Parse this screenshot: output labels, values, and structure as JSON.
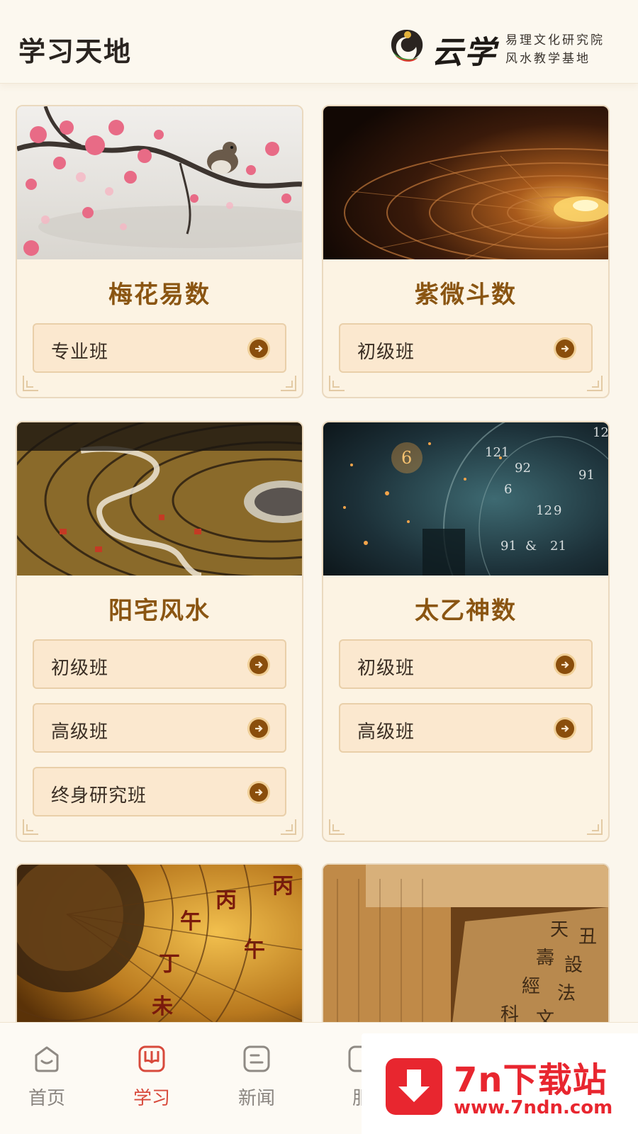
{
  "header": {
    "title": "学习天地",
    "logo": {
      "main": "云学",
      "line1": "易理文化研究院",
      "line2": "风水教学基地"
    }
  },
  "courses": [
    {
      "title": "梅花易数",
      "image": "plum-blossom-bird-image",
      "classes": [
        "专业班"
      ]
    },
    {
      "title": "紫微斗数",
      "image": "glowing-astrolabe-image",
      "classes": [
        "初级班"
      ]
    },
    {
      "title": "阳宅风水",
      "image": "luopan-compass-image",
      "classes": [
        "初级班",
        "高级班",
        "终身研究班"
      ]
    },
    {
      "title": "太乙神数",
      "image": "cosmic-numbers-image",
      "classes": [
        "初级班",
        "高级班"
      ]
    },
    {
      "title": "",
      "image": "golden-compass-image",
      "classes": []
    },
    {
      "title": "",
      "image": "ancient-books-image",
      "classes": []
    }
  ],
  "nav": {
    "items": [
      {
        "label": "首页",
        "icon": "home-smile-icon",
        "active": false
      },
      {
        "label": "学习",
        "icon": "book-icon",
        "active": true
      },
      {
        "label": "新闻",
        "icon": "news-icon",
        "active": false
      },
      {
        "label": "服",
        "icon": "service-icon",
        "active": false
      }
    ]
  },
  "watermark": {
    "title": "7n下载站",
    "url": "www.7ndn.com",
    "icon": "download-arrow-icon"
  },
  "colors": {
    "background": "#fbf6ec",
    "card": "#fcf3e3",
    "title_brown": "#8a5512",
    "active_red": "#d84a3c",
    "watermark_red": "#e8262f"
  }
}
